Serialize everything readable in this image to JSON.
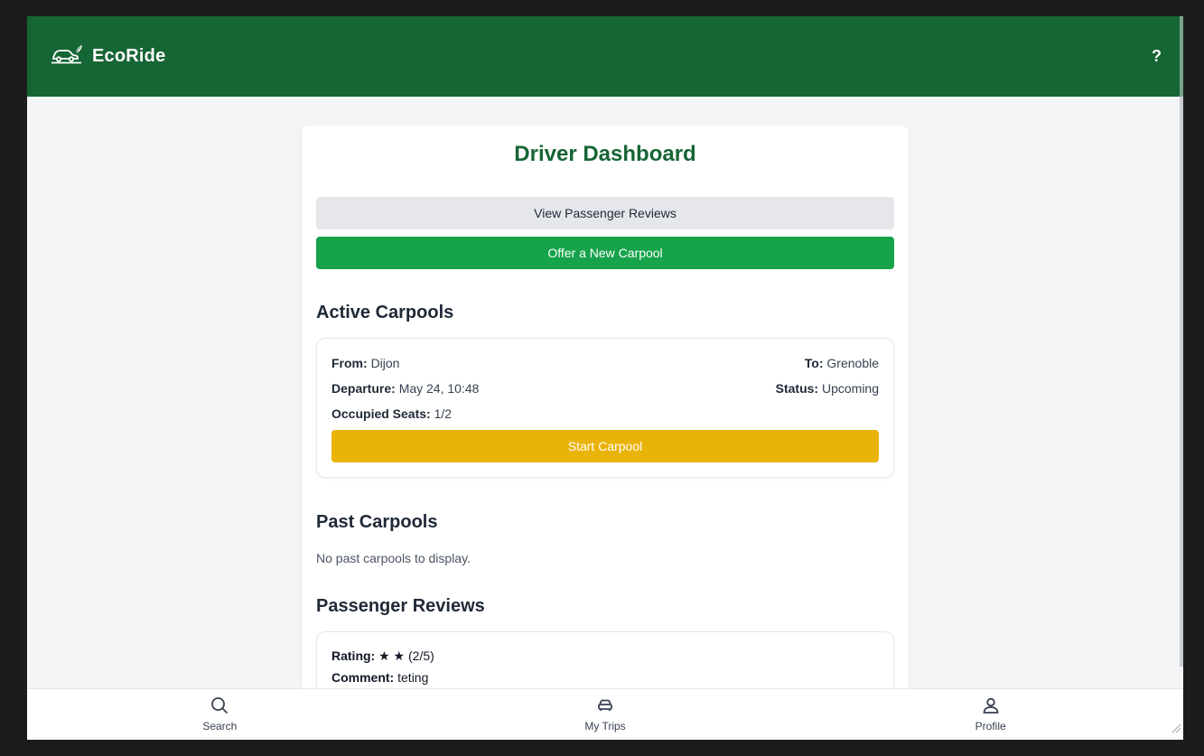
{
  "app": {
    "name": "EcoRide",
    "help_label": "?"
  },
  "colors": {
    "brand_green": "#166534",
    "action_green": "#16a34a",
    "start_yellow": "#eab308"
  },
  "dashboard": {
    "title": "Driver Dashboard",
    "view_reviews_label": "View Passenger Reviews",
    "offer_carpool_label": "Offer a New Carpool"
  },
  "active": {
    "heading": "Active Carpools",
    "carpool": {
      "from_label": "From:",
      "from": "Dijon",
      "to_label": "To:",
      "to": "Grenoble",
      "departure_label": "Departure:",
      "departure": "May 24, 10:48",
      "status_label": "Status:",
      "status": "Upcoming",
      "seats_label": "Occupied Seats:",
      "seats": "1/2",
      "start_label": "Start Carpool"
    }
  },
  "past": {
    "heading": "Past Carpools",
    "empty_text": "No past carpools to display."
  },
  "reviews": {
    "heading": "Passenger Reviews",
    "items": [
      {
        "rating_label": "Rating:",
        "stars": "★ ★",
        "score": "(2/5)",
        "comment_label": "Comment:",
        "comment": "teting"
      }
    ]
  },
  "nav": [
    {
      "label": "Search",
      "icon": "search-icon"
    },
    {
      "label": "My Trips",
      "icon": "car-icon"
    },
    {
      "label": "Profile",
      "icon": "user-icon"
    }
  ]
}
